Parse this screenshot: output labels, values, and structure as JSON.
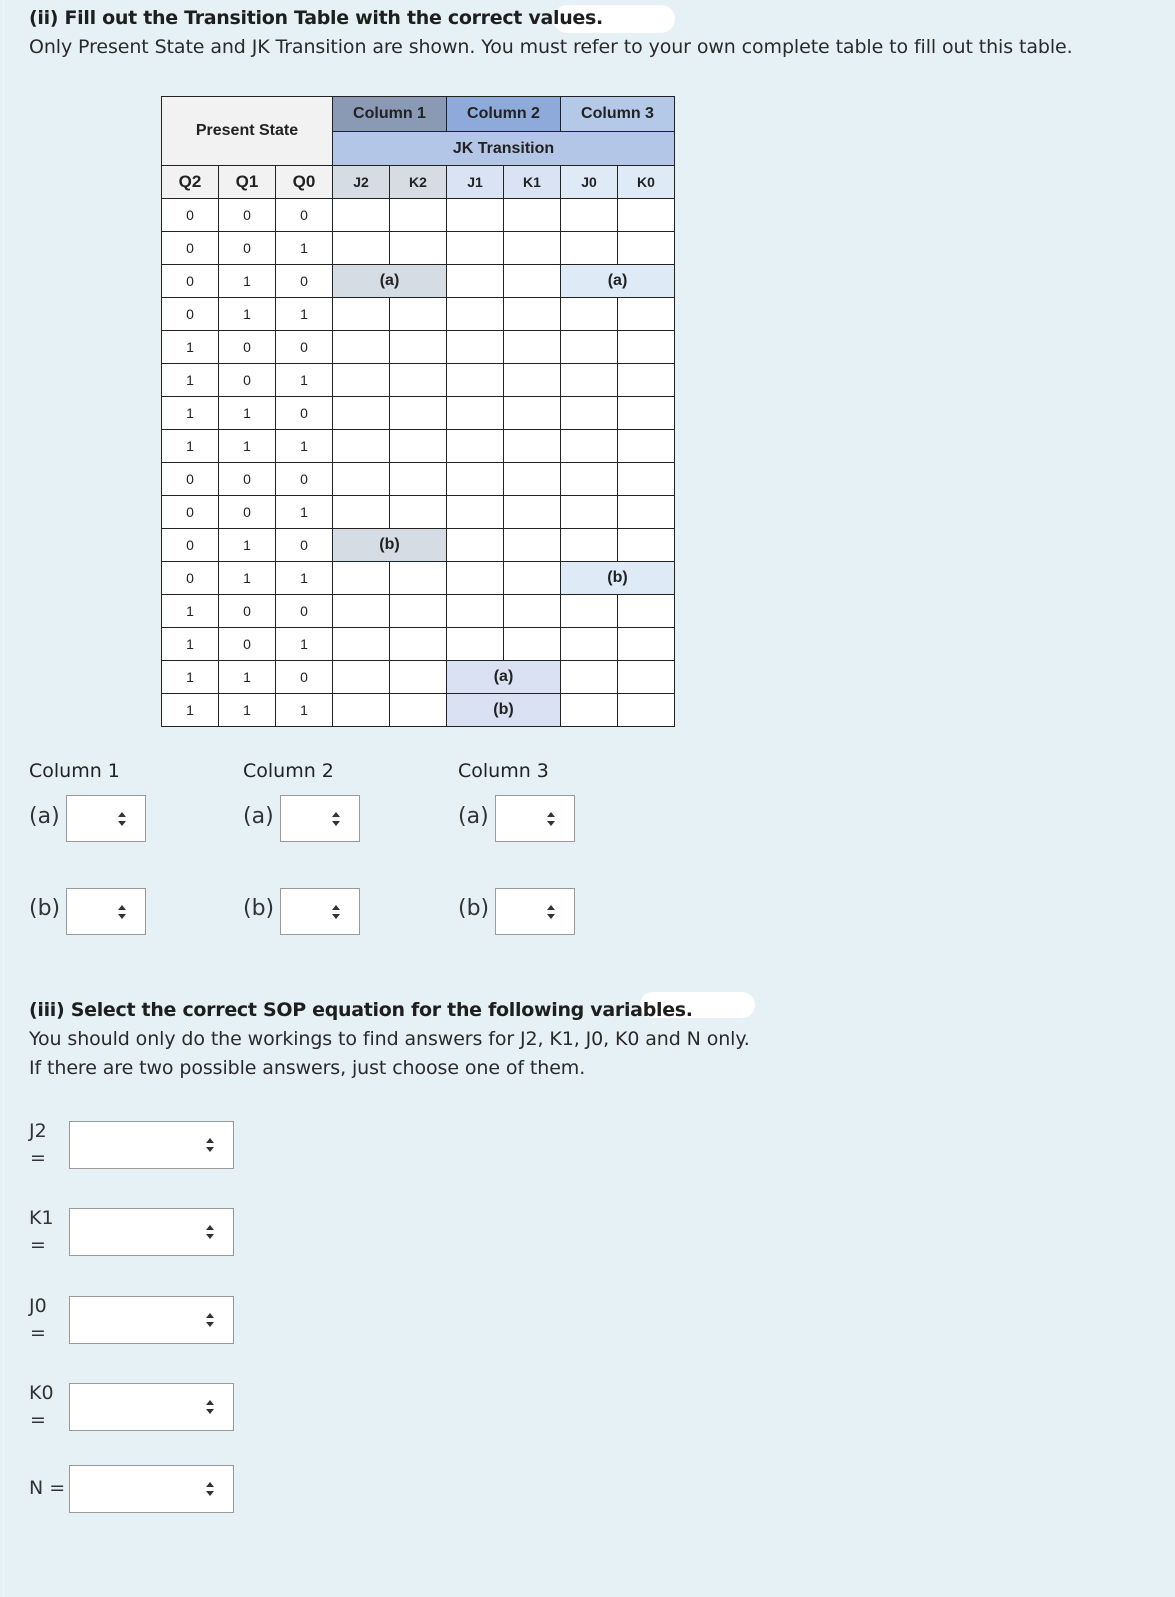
{
  "section_ii": {
    "title": "(ii) Fill out the Transition Table with the correct values.",
    "instruction": "Only Present State and JK Transition are shown. You must refer to your own complete table to fill out this table."
  },
  "table": {
    "present_state_header": "Present State",
    "column_headers": [
      "Column 1",
      "Column 2",
      "Column 3"
    ],
    "jk_header": "JK Transition",
    "subheaders": [
      "Q2",
      "Q1",
      "Q0",
      "J2",
      "K2",
      "J1",
      "K1",
      "J0",
      "K0"
    ],
    "rows": [
      {
        "q": [
          "0",
          "0",
          "0"
        ]
      },
      {
        "q": [
          "0",
          "0",
          "1"
        ]
      },
      {
        "q": [
          "0",
          "1",
          "0"
        ],
        "c1": "(a)",
        "c3": "(a)"
      },
      {
        "q": [
          "0",
          "1",
          "1"
        ]
      },
      {
        "q": [
          "1",
          "0",
          "0"
        ]
      },
      {
        "q": [
          "1",
          "0",
          "1"
        ]
      },
      {
        "q": [
          "1",
          "1",
          "0"
        ]
      },
      {
        "q": [
          "1",
          "1",
          "1"
        ]
      },
      {
        "q": [
          "0",
          "0",
          "0"
        ]
      },
      {
        "q": [
          "0",
          "0",
          "1"
        ]
      },
      {
        "q": [
          "0",
          "1",
          "0"
        ],
        "c1": "(b)"
      },
      {
        "q": [
          "0",
          "1",
          "1"
        ],
        "c3": "(b)"
      },
      {
        "q": [
          "1",
          "0",
          "0"
        ]
      },
      {
        "q": [
          "1",
          "0",
          "1"
        ]
      },
      {
        "q": [
          "1",
          "1",
          "0"
        ],
        "c2": "(a)"
      },
      {
        "q": [
          "1",
          "1",
          "1"
        ],
        "c2": "(b)"
      }
    ]
  },
  "answers_ii": {
    "columns": [
      {
        "label": "Column 1",
        "a_label": "(a)",
        "b_label": "(b)",
        "a_value": "",
        "b_value": ""
      },
      {
        "label": "Column 2",
        "a_label": "(a)",
        "b_label": "(b)",
        "a_value": "",
        "b_value": ""
      },
      {
        "label": "Column 3",
        "a_label": "(a)",
        "b_label": "(b)",
        "a_value": "",
        "b_value": ""
      }
    ]
  },
  "section_iii": {
    "title": "(iii) Select the correct SOP equation for the following variables.",
    "instruction1": "You should only do the workings to find answers for J2, K1, J0, K0 and N only.",
    "instruction2": "If there are two possible answers, just choose one of them.",
    "variables": [
      {
        "name": "J2",
        "eq": "=",
        "value": ""
      },
      {
        "name": "K1",
        "eq": "=",
        "value": ""
      },
      {
        "name": "J0",
        "eq": "=",
        "value": ""
      },
      {
        "name": "K0",
        "eq": "=",
        "value": ""
      },
      {
        "name": "N =",
        "eq": "",
        "value": ""
      }
    ]
  },
  "icons": {
    "select_arrow": "up-down-chevron-icon"
  },
  "colors": {
    "page_bg": "#e6f1f5",
    "column1_header": "#8a9ab5",
    "column2_header": "#8eaadb",
    "column3_header": "#b4c9e8",
    "jk_header": "#b4c6e7",
    "present_state_header": "#f2f2f2"
  }
}
